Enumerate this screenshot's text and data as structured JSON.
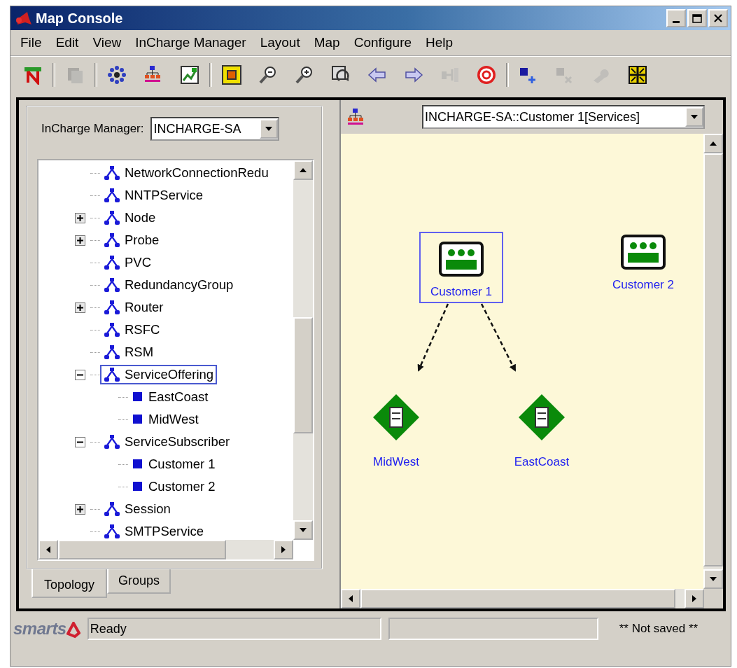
{
  "window": {
    "title": "Map Console"
  },
  "menu": [
    "File",
    "Edit",
    "View",
    "InCharge Manager",
    "Layout",
    "Map",
    "Configure",
    "Help"
  ],
  "toolbar_groups": [
    [
      {
        "kind": "new-map",
        "disabled": false
      }
    ],
    [
      {
        "kind": "copy",
        "disabled": true
      }
    ],
    [
      {
        "kind": "cluster",
        "disabled": false
      },
      {
        "kind": "hierarchy",
        "disabled": false
      },
      {
        "kind": "map-view",
        "disabled": false
      }
    ],
    [
      {
        "kind": "frame",
        "disabled": false
      },
      {
        "kind": "zoom-out",
        "disabled": false
      },
      {
        "kind": "zoom-in",
        "disabled": false
      },
      {
        "kind": "refresh",
        "disabled": false
      },
      {
        "kind": "back",
        "disabled": false
      },
      {
        "kind": "forward",
        "disabled": false
      },
      {
        "kind": "connector",
        "disabled": true
      },
      {
        "kind": "target",
        "disabled": false
      }
    ],
    [
      {
        "kind": "add-node",
        "disabled": false
      },
      {
        "kind": "remove-node",
        "disabled": true
      },
      {
        "kind": "wrench",
        "disabled": true
      },
      {
        "kind": "fit",
        "disabled": false
      }
    ]
  ],
  "manager": {
    "label": "InCharge Manager:",
    "value": "INCHARGE-SA"
  },
  "tree": {
    "items": [
      {
        "label": "NetworkConnectionRedu",
        "kind": "class",
        "selected": false
      },
      {
        "label": "NNTPService",
        "kind": "class",
        "selected": false
      },
      {
        "label": "Node",
        "kind": "class",
        "expanded": false,
        "selected": false
      },
      {
        "label": "Probe",
        "kind": "class",
        "expanded": false,
        "selected": false
      },
      {
        "label": "PVC",
        "kind": "class",
        "selected": false
      },
      {
        "label": "RedundancyGroup",
        "kind": "class",
        "selected": false
      },
      {
        "label": "Router",
        "kind": "class",
        "expanded": false,
        "selected": false
      },
      {
        "label": "RSFC",
        "kind": "class",
        "selected": false
      },
      {
        "label": "RSM",
        "kind": "class",
        "selected": false
      },
      {
        "label": "ServiceOffering",
        "kind": "class",
        "expanded": true,
        "selected": true,
        "children": [
          {
            "label": "EastCoast",
            "kind": "instance",
            "selected": false
          },
          {
            "label": "MidWest",
            "kind": "instance",
            "selected": false
          }
        ]
      },
      {
        "label": "ServiceSubscriber",
        "kind": "class",
        "expanded": true,
        "selected": false,
        "children": [
          {
            "label": "Customer 1",
            "kind": "instance",
            "selected": false
          },
          {
            "label": "Customer 2",
            "kind": "instance",
            "selected": false
          }
        ]
      },
      {
        "label": "Session",
        "kind": "class",
        "expanded": false,
        "selected": false
      },
      {
        "label": "SMTPService",
        "kind": "class",
        "selected": false
      }
    ]
  },
  "tabs": [
    {
      "label": "Topology",
      "selected": true
    },
    {
      "label": "Groups",
      "selected": false
    }
  ],
  "map": {
    "view": "INCHARGE-SA::Customer 1[Services]",
    "nodes": [
      {
        "label": "Customer 1",
        "kind": "subscriber",
        "selected": true,
        "linked": false
      },
      {
        "label": "Customer 2",
        "kind": "subscriber",
        "selected": false,
        "linked": false
      },
      {
        "label": "MidWest",
        "kind": "offering",
        "selected": false,
        "linked": true
      },
      {
        "label": "EastCoast",
        "kind": "offering",
        "selected": false,
        "linked": true
      }
    ]
  },
  "status_bar": {
    "logo": "smarts",
    "message": "Ready",
    "save_state": "** Not saved **"
  }
}
